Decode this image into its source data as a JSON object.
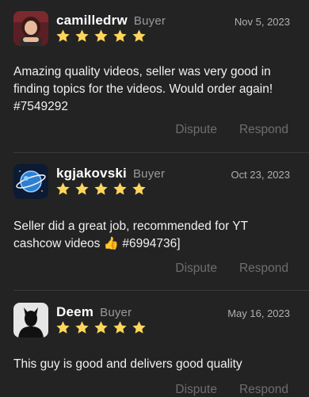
{
  "colors": {
    "background": "#232323",
    "star": "#ffd65c",
    "muted_action": "#6e6e6e",
    "divider": "#3a3a3a"
  },
  "reviews": [
    {
      "username": "camilledrw",
      "role": "Buyer",
      "date": "Nov 5, 2023",
      "rating": 5,
      "text": "Amazing quality videos, seller was very good in finding topics for the videos. Would order again! #7549292",
      "actions": {
        "dispute": "Dispute",
        "respond": "Respond"
      }
    },
    {
      "username": "kgjakovski",
      "role": "Buyer",
      "date": "Oct 23, 2023",
      "rating": 5,
      "text": "Seller did a great job, recommended for YT cashcow videos 👍 #6994736]",
      "actions": {
        "dispute": "Dispute",
        "respond": "Respond"
      }
    },
    {
      "username": "Deem",
      "role": "Buyer",
      "date": "May 16, 2023",
      "rating": 5,
      "text": "This guy is good and delivers good quality",
      "actions": {
        "dispute": "Dispute",
        "respond": "Respond"
      }
    }
  ]
}
